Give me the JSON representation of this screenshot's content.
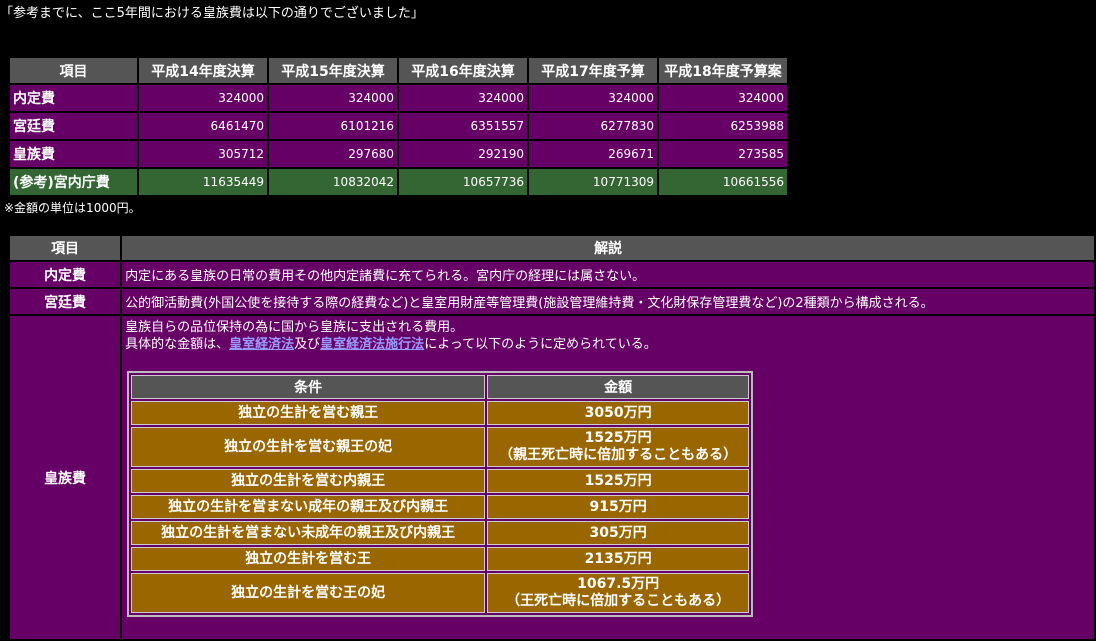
{
  "intro": "「参考までに、ここ5年間における皇族費は以下の通りでございました」",
  "budget": {
    "headers": [
      "項目",
      "平成14年度決算",
      "平成15年度決算",
      "平成16年度決算",
      "平成17年度予算",
      "平成18年度予算案"
    ],
    "rows": [
      {
        "label": "内定費",
        "values": [
          "324000",
          "324000",
          "324000",
          "324000",
          "324000"
        ]
      },
      {
        "label": "宮廷費",
        "values": [
          "6461470",
          "6101216",
          "6351557",
          "6277830",
          "6253988"
        ]
      },
      {
        "label": "皇族費",
        "values": [
          "305712",
          "297680",
          "292190",
          "269671",
          "273585"
        ]
      },
      {
        "label": "(参考)宮内庁費",
        "values": [
          "11635449",
          "10832042",
          "10657736",
          "10771309",
          "10661556"
        ]
      }
    ],
    "note": "※金額の単位は1000円。"
  },
  "explain": {
    "headers": [
      "項目",
      "解説"
    ],
    "rows": [
      {
        "label": "内定費",
        "text": "内定にある皇族の日常の費用その他内定諸費に充てられる。宮内庁の経理には属さない。"
      },
      {
        "label": "宮廷費",
        "text": "公的御活動費(外国公使を接待する際の経費など)と皇室用財産等管理費(施設管理維持費・文化財保存管理費など)の2種類から構成される。"
      },
      {
        "label": "皇族費",
        "line1": "皇族自らの品位保持の為に国から皇族に支出される費用。",
        "line2_pre": "具体的な金額は、",
        "link1": "皇室経済法",
        "line2_mid": "及び",
        "link2": "皇室経済法施行法",
        "line2_post": "によって以下のように定められている。"
      }
    ]
  },
  "allowance": {
    "headers": [
      "条件",
      "金額"
    ],
    "rows": [
      {
        "cond": "独立の生計を営む親王",
        "amount": "3050万円",
        "amount2": ""
      },
      {
        "cond": "独立の生計を営む親王の妃",
        "amount": "1525万円",
        "amount2": "（親王死亡時に倍加することもある）"
      },
      {
        "cond": "独立の生計を営む内親王",
        "amount": "1525万円",
        "amount2": ""
      },
      {
        "cond": "独立の生計を営まない成年の親王及び内親王",
        "amount": "915万円",
        "amount2": ""
      },
      {
        "cond": "独立の生計を営まない未成年の親王及び内親王",
        "amount": "305万円",
        "amount2": ""
      },
      {
        "cond": "独立の生計を営む王",
        "amount": "2135万円",
        "amount2": ""
      },
      {
        "cond": "独立の生計を営む王の妃",
        "amount": "1067.5万円",
        "amount2": "（王死亡時に倍加することもある）"
      }
    ]
  },
  "colors": {
    "row_bg": "#660066",
    "ref_bg": "#336633",
    "header_bg": "#555555",
    "allow_bg": "#996600",
    "link": "#9999ff"
  }
}
